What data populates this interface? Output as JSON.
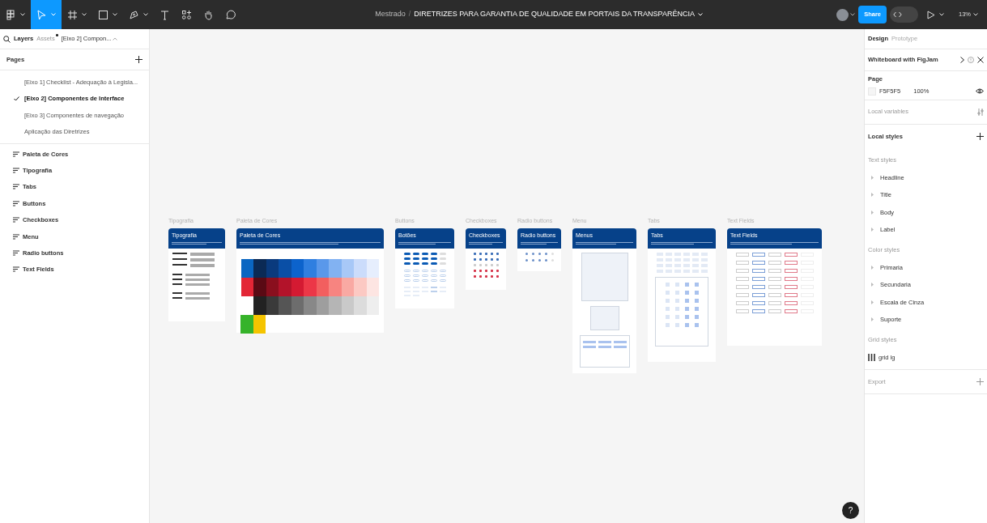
{
  "topbar": {
    "tools": [
      {
        "kind": "main-menu",
        "selected": false,
        "has_menu": true
      },
      {
        "kind": "move",
        "selected": true,
        "has_menu": true
      },
      {
        "kind": "frame",
        "selected": false,
        "has_menu": true
      },
      {
        "kind": "shape",
        "selected": false,
        "has_menu": true
      },
      {
        "kind": "pen",
        "selected": false,
        "has_menu": true
      },
      {
        "kind": "text",
        "selected": false,
        "has_menu": false
      },
      {
        "kind": "resources",
        "selected": false,
        "has_menu": false
      },
      {
        "kind": "hand",
        "selected": false,
        "has_menu": false
      },
      {
        "kind": "comment",
        "selected": false,
        "has_menu": false
      }
    ],
    "breadcrumb": {
      "project": "Mestrado",
      "separator": "/",
      "file": "DIRETRIZES PARA GARANTIA DE QUALIDADE EM PORTAIS DA TRANSPARÊNCIA"
    },
    "share": "Share",
    "dev_mode": false,
    "zoom": "13%"
  },
  "left_panel": {
    "tabs": [
      {
        "label": "Layers",
        "selected": true,
        "dot": false
      },
      {
        "label": "Assets",
        "selected": false,
        "dot": true
      }
    ],
    "page_picker": "[Eixo 2] Compon...",
    "pages_heading": "Pages",
    "pages": [
      {
        "label": "[Eixo 1] Checklist - Adequação à Legisla...",
        "selected": false
      },
      {
        "label": "[Eixo 2] Componentes de Interface",
        "selected": true
      },
      {
        "label": "[Eixo 3] Componentes de navegação",
        "selected": false
      },
      {
        "label": "Aplicação das Diretrizes",
        "selected": false
      }
    ],
    "layers": [
      "Paleta de Cores",
      "Tipografia",
      "Tabs",
      "Buttons",
      "Checkboxes",
      "Menu",
      "Radio buttons",
      "Text Fields"
    ]
  },
  "canvas": {
    "frames": [
      {
        "label": "Tipografia",
        "title": "Tipografia",
        "kind": "typography"
      },
      {
        "label": "Paleta de Cores",
        "title": "Paleta de Cores",
        "kind": "palette"
      },
      {
        "label": "Buttons",
        "title": "Botões",
        "kind": "buttons"
      },
      {
        "label": "Checkboxes",
        "title": "Checkboxes",
        "kind": "checkboxes"
      },
      {
        "label": "Radio buttons",
        "title": "Radio buttons",
        "kind": "radios"
      },
      {
        "label": "Menu",
        "title": "Menus",
        "kind": "menus"
      },
      {
        "label": "Tabs",
        "title": "Tabs",
        "kind": "tabs"
      },
      {
        "label": "Text Fields",
        "title": "Text Fields",
        "kind": "textfields"
      }
    ],
    "help": "?"
  },
  "right_panel": {
    "tabs": [
      {
        "label": "Design",
        "selected": true
      },
      {
        "label": "Prototype",
        "selected": false
      }
    ],
    "banner": "Whiteboard with FigJam",
    "page": {
      "heading": "Page",
      "fill_hex": "F5F5F5",
      "opacity": "100%"
    },
    "local_variables": "Local variables",
    "local_styles": "Local styles",
    "style_groups": [
      {
        "heading": "Text styles",
        "kind": "text",
        "items": [
          "Headline",
          "Title",
          "Body",
          "Label"
        ]
      },
      {
        "heading": "Color styles",
        "kind": "color",
        "items": [
          "Primaria",
          "Secundaria",
          "Escala de Cinza",
          "Suporte"
        ]
      },
      {
        "heading": "Grid styles",
        "kind": "grid",
        "items": [
          "grid lg"
        ]
      }
    ],
    "export": "Export"
  }
}
